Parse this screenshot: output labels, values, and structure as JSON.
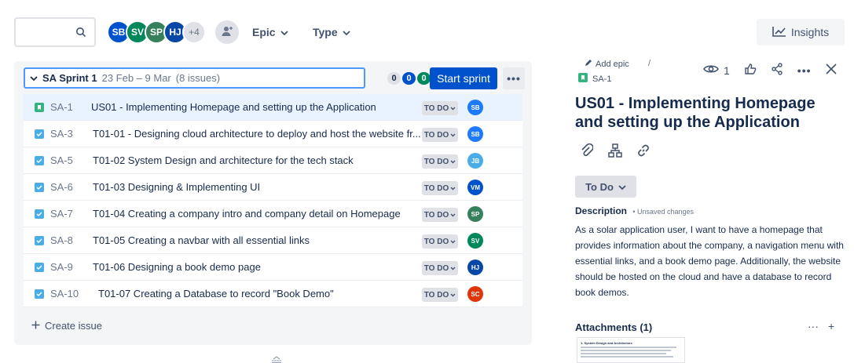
{
  "toolbar": {
    "search_placeholder": "",
    "avatars": [
      {
        "initials": "SB",
        "color": "#0052CC"
      },
      {
        "initials": "SV",
        "color": "#00875A"
      },
      {
        "initials": "SP",
        "color": "#36805C"
      },
      {
        "initials": "HJ",
        "color": "#0747A6"
      }
    ],
    "more_avatars": "+4",
    "epic_label": "Epic",
    "type_label": "Type",
    "insights_label": "Insights"
  },
  "sprint": {
    "name": "SA Sprint 1",
    "dates": "23 Feb – 9 Mar",
    "issue_count": "(8 issues)",
    "counts": {
      "todo": "0",
      "in_progress": "0",
      "done": "0"
    },
    "start_label": "Start sprint",
    "more_label": "•••",
    "create_issue_label": "Create issue"
  },
  "issues": [
    {
      "key": "SA-1",
      "summary": "US01 - Implementing Homepage and setting up the Application",
      "type": "story",
      "status": "TO DO",
      "assignee": "SB",
      "assignee_color": "#1D7AFC",
      "selected": true
    },
    {
      "key": "SA-3",
      "summary": "T01-01 - Designing cloud architecture to deploy and host the website fr...",
      "type": "task",
      "status": "TO DO",
      "assignee": "SB",
      "assignee_color": "#1D7AFC"
    },
    {
      "key": "SA-5",
      "summary": "T01-02 System Design and architecture for the tech stack",
      "type": "task",
      "status": "TO DO",
      "assignee": "JB",
      "assignee_color": "#4BADE8"
    },
    {
      "key": "SA-6",
      "summary": "T01-03 Designing & Implementing UI",
      "type": "task",
      "status": "TO DO",
      "assignee": "VM",
      "assignee_color": "#0052CC"
    },
    {
      "key": "SA-7",
      "summary": "T01-04 Creating a company intro and company detail on Homepage",
      "type": "task",
      "status": "TO DO",
      "assignee": "SP",
      "assignee_color": "#36805C"
    },
    {
      "key": "SA-8",
      "summary": "T01-05 Creating a navbar with all essential links",
      "type": "task",
      "status": "TO DO",
      "assignee": "SV",
      "assignee_color": "#00875A"
    },
    {
      "key": "SA-9",
      "summary": "T01-06 Designing a book demo page",
      "type": "task",
      "status": "TO DO",
      "assignee": "HJ",
      "assignee_color": "#0747A6"
    },
    {
      "key": "SA-10",
      "summary": "T01-07 Creating a Database to record \"Book Demo\"",
      "type": "task",
      "status": "TO DO",
      "assignee": "SC",
      "assignee_color": "#DE350B"
    }
  ],
  "detail": {
    "add_epic_label": "Add epic",
    "separator": "/",
    "key": "SA-1",
    "watchers": "1",
    "title": "US01 - Implementing Homepage and setting up the Application",
    "status_label": "To Do",
    "description_label": "Description",
    "unsaved_label": "• Unsaved changes",
    "description": "As a solar application user, I want to have a homepage that provides information about the company, a navigation menu with essential links, and a book demo page. Additionally, the website should be hosted on the cloud and have a database to record book demos.",
    "attachments_label": "Attachments (1)",
    "attachment_heading": "1. System Design and Architecture"
  }
}
